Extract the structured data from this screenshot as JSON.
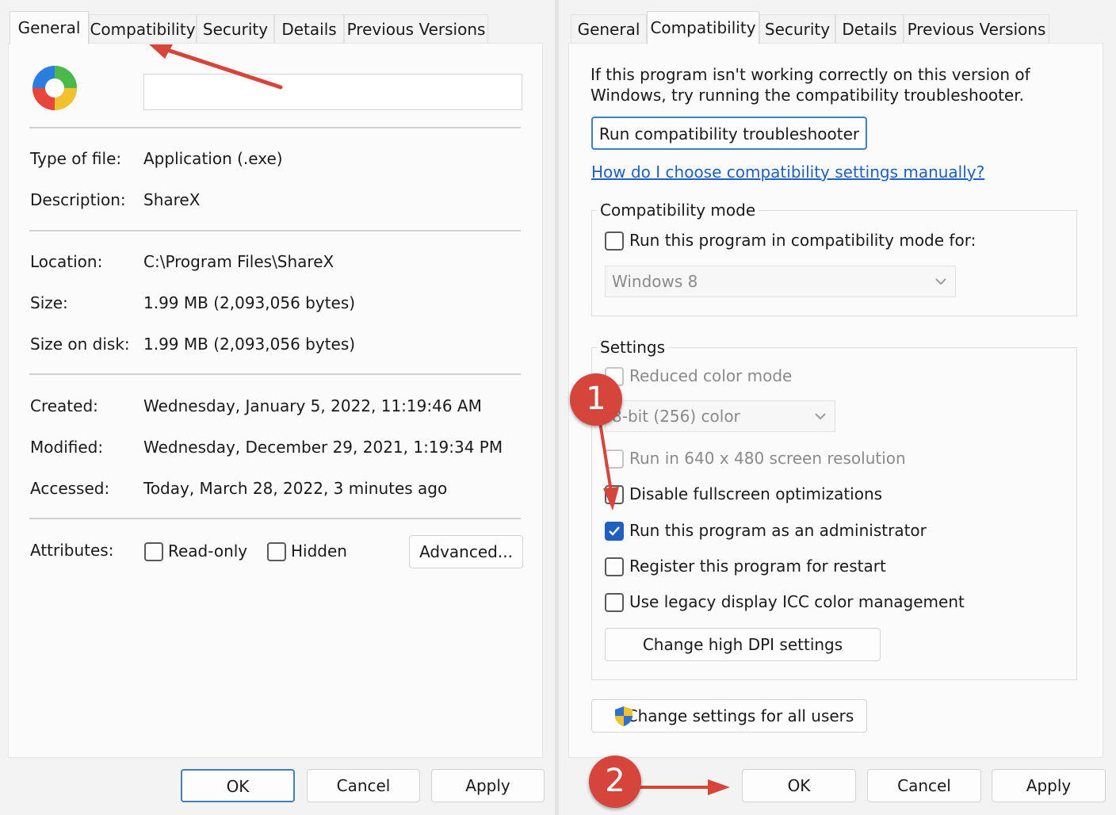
{
  "left_dialog": {
    "tabs": [
      "General",
      "Compatibility",
      "Security",
      "Details",
      "Previous Versions"
    ],
    "active_tab": "General",
    "file_name_value": "",
    "app_icon": "sharex-logo",
    "properties": [
      {
        "label": "Type of file:",
        "value": "Application (.exe)"
      },
      {
        "label": "Description:",
        "value": "ShareX"
      },
      {
        "label": "Location:",
        "value": "C:\\Program Files\\ShareX"
      },
      {
        "label": "Size:",
        "value": "1.99 MB (2,093,056 bytes)"
      },
      {
        "label": "Size on disk:",
        "value": "1.99 MB (2,093,056 bytes)"
      },
      {
        "label": "Created:",
        "value": "Wednesday, January 5, 2022, 11:19:46 AM"
      },
      {
        "label": "Modified:",
        "value": "Wednesday, December 29, 2021, 1:19:34 PM"
      },
      {
        "label": "Accessed:",
        "value": "Today, March 28, 2022, 3 minutes ago"
      }
    ],
    "attributes": {
      "label": "Attributes:",
      "readonly": {
        "label": "Read-only",
        "checked": false
      },
      "hidden": {
        "label": "Hidden",
        "checked": false
      },
      "advanced_button": "Advanced..."
    },
    "buttons": {
      "ok": "OK",
      "cancel": "Cancel",
      "apply": "Apply"
    }
  },
  "right_dialog": {
    "tabs": [
      "General",
      "Compatibility",
      "Security",
      "Details",
      "Previous Versions"
    ],
    "active_tab": "Compatibility",
    "intro_text": "If this program isn't working correctly on this version of Windows, try running the compatibility troubleshooter.",
    "troubleshooter_button": "Run compatibility troubleshooter",
    "manual_link": "How do I choose compatibility settings manually?",
    "compat_mode": {
      "title": "Compatibility mode",
      "checkbox": {
        "label": "Run this program in compatibility mode for:",
        "checked": false
      },
      "select_value": "Windows 8"
    },
    "settings": {
      "title": "Settings",
      "reduced_color": {
        "label": "Reduced color mode",
        "checked": false,
        "enabled": false
      },
      "color_select_value": "8-bit (256) color",
      "res_640": {
        "label": "Run in 640 x 480 screen resolution",
        "checked": false,
        "enabled": false
      },
      "disable_fullscreen": {
        "label": "Disable fullscreen optimizations",
        "checked": false
      },
      "run_as_admin": {
        "label": "Run this program as an administrator",
        "checked": true
      },
      "register_restart": {
        "label": "Register this program for restart",
        "checked": false
      },
      "legacy_icc": {
        "label": "Use legacy display ICC color management",
        "checked": false
      },
      "dpi_button": "Change high DPI settings"
    },
    "all_users_button": "Change settings for all users",
    "buttons": {
      "ok": "OK",
      "cancel": "Cancel",
      "apply": "Apply"
    }
  },
  "annotations": {
    "badge_1": "1",
    "badge_2": "2",
    "arrow_color": "#d6453c"
  },
  "colors": {
    "accent": "#1f5fbf",
    "dialog_bg": "#f3f3f3",
    "panel_bg": "#fbfbfb"
  }
}
